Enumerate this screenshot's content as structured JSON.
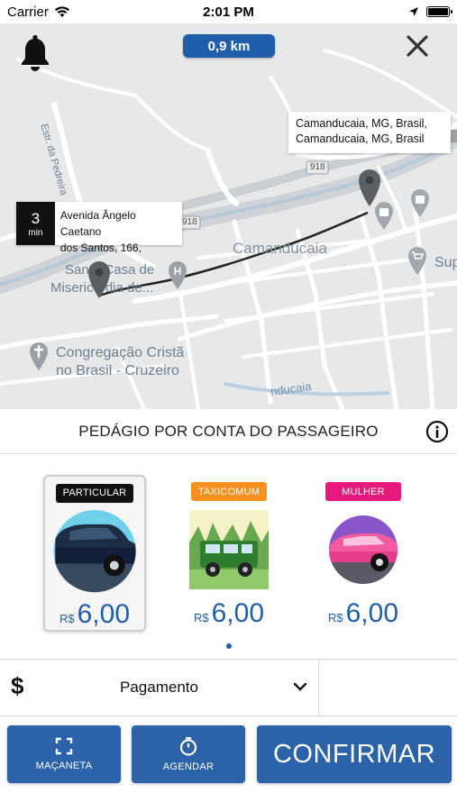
{
  "status_bar": {
    "carrier": "Carrier",
    "time": "2:01 PM"
  },
  "map": {
    "distance": "0,9 km",
    "destination_callout": {
      "line1": "Camanducaia, MG, Brasil,",
      "line2": "Camanducaia, MG, Brasil"
    },
    "origin_callout": {
      "eta_value": "3",
      "eta_unit": "min",
      "line1": "Avenida Ângelo Caetano",
      "line2": "dos Santos, 166,"
    },
    "place_labels": {
      "road_estr": "Estr. da Pedreira",
      "route_918_a": "918",
      "route_918_b": "918",
      "city": "Camanducaia",
      "santa_casa_1": "Santa Casa de",
      "santa_casa_2": "Misericórdia de...",
      "congregacao_1": "Congregação Cristã",
      "congregacao_2": "no Brasil - Cruzeiro",
      "super": "Sup",
      "river": "nducaia"
    },
    "route_color": "#222222",
    "pin_color": "#5b5e63"
  },
  "toll": {
    "text": "PEDÁGIO POR CONTA DO PASSAGEIRO"
  },
  "categories": [
    {
      "badge": "PARTICULAR",
      "badge_color": "#111111",
      "currency": "R$",
      "price": "6,00",
      "selected": true,
      "icon": "dark-car-icon"
    },
    {
      "badge": "TAXICOMUM",
      "badge_color": "#f7901e",
      "currency": "R$",
      "price": "6,00",
      "selected": false,
      "icon": "green-jeep-icon"
    },
    {
      "badge": "MULHER",
      "badge_color": "#e8197d",
      "currency": "R$",
      "price": "6,00",
      "selected": false,
      "icon": "pink-car-icon"
    }
  ],
  "payment": {
    "symbol": "$",
    "label": "Pagamento"
  },
  "actions": {
    "handle_label": "MAÇANETA",
    "schedule_label": "AGENDAR",
    "confirm_label": "CONFIRMAR"
  },
  "colors": {
    "accent": "#2b62a8",
    "price": "#1f5fa9"
  }
}
